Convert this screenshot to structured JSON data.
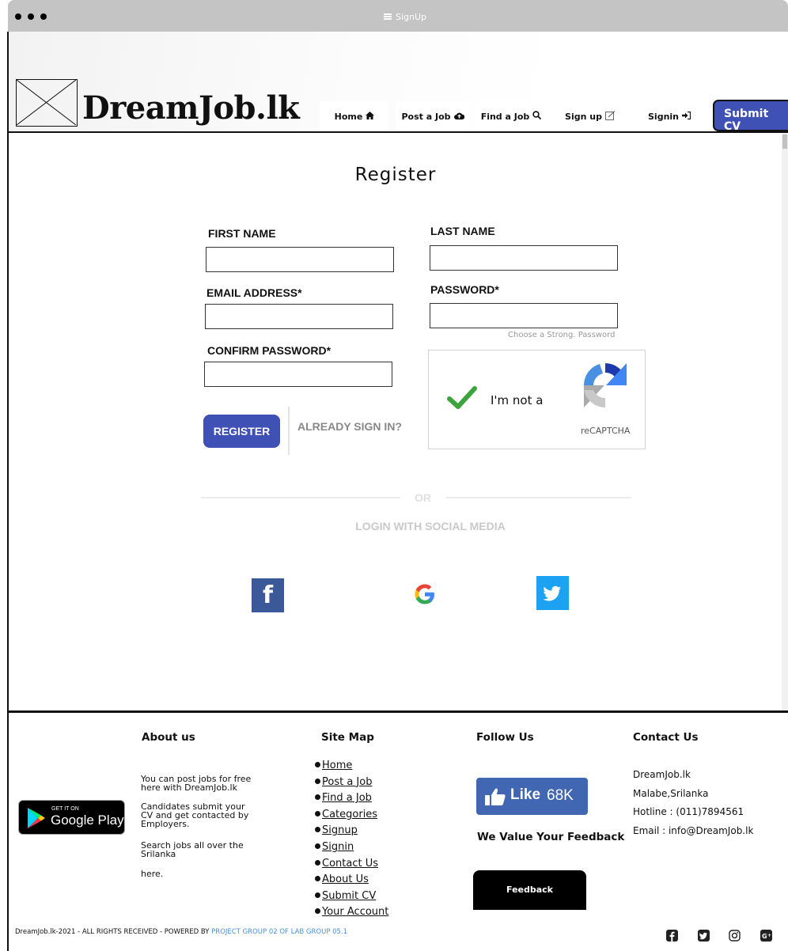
{
  "window": {
    "title": "SignUp"
  },
  "header": {
    "logo_text": "DreamJob.lk",
    "nav": [
      {
        "label": "Home",
        "icon": "home-icon"
      },
      {
        "label": "Post a Job",
        "icon": "cloud-upload-icon"
      },
      {
        "label": "Find a Job",
        "icon": "search-icon"
      },
      {
        "label": "Sign up",
        "icon": "edit-icon"
      },
      {
        "label": "Signin",
        "icon": "sign-in-icon"
      }
    ],
    "submit_cv": "Submit CV"
  },
  "form": {
    "title": "Register",
    "first_name_label": "FIRST NAME",
    "last_name_label": "LAST NAME",
    "email_label": "EMAIL ADDRESS*",
    "password_label": "PASSWORD*",
    "confirm_label": "CONFIRM PASSWORD*",
    "password_hint": "Choose a Strong. Password",
    "captcha_text": "I'm not a",
    "captcha_brand": "reCAPTCHA",
    "register_button": "REGISTER",
    "already_link": "ALREADY SIGN IN?",
    "or_text": "OR",
    "social_title": "LOGIN WITH SOCIAL MEDIA"
  },
  "footer": {
    "about_title": "About us",
    "about_lines": [
      "You can post jobs for free here with DreamJob.lk",
      "Candidates submit your CV and get contacted by Employers.",
      "Search jobs all over the Srilanka",
      "here."
    ],
    "google_play_small": "GET IT ON",
    "google_play_big": "Google Play",
    "sitemap_title": "Site Map",
    "sitemap": [
      "Home",
      "Post a Job",
      "Find a Job",
      "Categories",
      "Signup",
      "Signin",
      "Contact Us",
      "About Us",
      "Submit CV",
      "Your Account"
    ],
    "follow_title": "Follow Us",
    "like_label": "Like",
    "like_count": "68K",
    "value_text": "We Value Your Feedback",
    "feedback_button": "Feedback",
    "contact_title": "Contact Us",
    "contact_lines": [
      "DreamJob.lk",
      "Malabe,Srilanka",
      "Hotline : (011)7894561",
      "Email  : info@DreamJob.lk"
    ],
    "copyright": "DreamJob.lk-2021 - ALL RIGHTS RECEIVED - POWERED BY ",
    "copyright_link": "PROJECT GROUP 02 OF LAB GROUP 05.1"
  },
  "colors": {
    "accent": "#3f51b5",
    "facebook": "#3b5998",
    "twitter": "#1da1f2"
  }
}
